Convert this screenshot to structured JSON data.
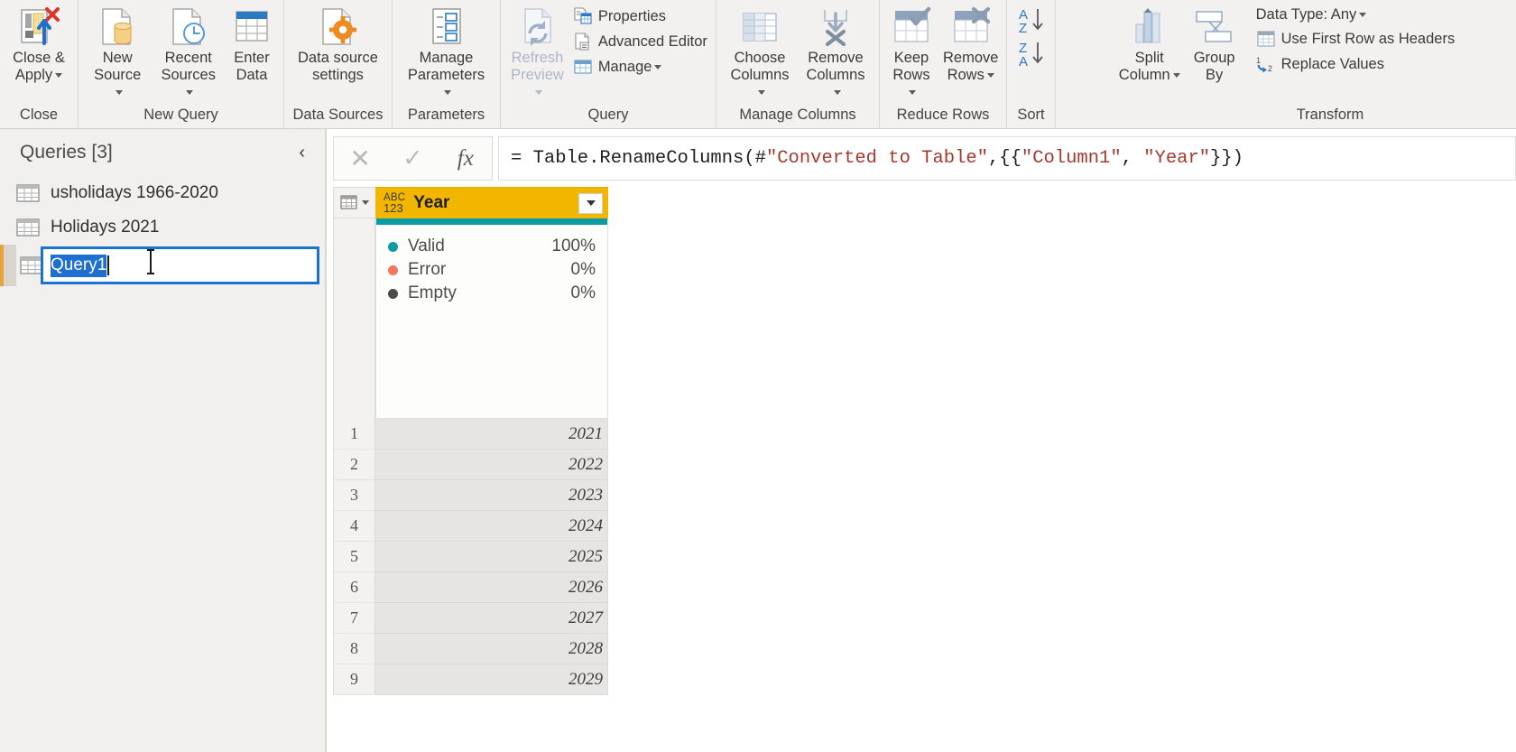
{
  "ribbon": {
    "groups": [
      {
        "title": "Close",
        "items": [
          {
            "label": "Close &\nApply",
            "icon": "close-and-apply-icon",
            "dropdown": true
          }
        ]
      },
      {
        "title": "New Query",
        "items": [
          {
            "label": "New\nSource",
            "icon": "new-source-icon",
            "dropdown": true
          },
          {
            "label": "Recent\nSources",
            "icon": "recent-sources-icon",
            "dropdown": true
          },
          {
            "label": "Enter\nData",
            "icon": "enter-data-icon",
            "dropdown": false
          }
        ]
      },
      {
        "title": "Data Sources",
        "items": [
          {
            "label": "Data source\nsettings",
            "icon": "data-source-settings-icon",
            "dropdown": false
          }
        ]
      },
      {
        "title": "Parameters",
        "items": [
          {
            "label": "Manage\nParameters",
            "icon": "manage-parameters-icon",
            "dropdown": true
          }
        ]
      },
      {
        "title": "Query",
        "items": [
          {
            "label": "Refresh\nPreview",
            "icon": "refresh-preview-icon",
            "dropdown": true,
            "disabled": true
          }
        ],
        "small_items": [
          {
            "label": "Properties",
            "icon": "properties-icon",
            "dropdown": false
          },
          {
            "label": "Advanced Editor",
            "icon": "advanced-editor-icon",
            "dropdown": false
          },
          {
            "label": "Manage",
            "icon": "manage-icon",
            "dropdown": true
          }
        ]
      },
      {
        "title": "Manage Columns",
        "items": [
          {
            "label": "Choose\nColumns",
            "icon": "choose-columns-icon",
            "dropdown": true
          },
          {
            "label": "Remove\nColumns",
            "icon": "remove-columns-icon",
            "dropdown": true
          }
        ]
      },
      {
        "title": "Reduce Rows",
        "items": [
          {
            "label": "Keep\nRows",
            "icon": "keep-rows-icon",
            "dropdown": true
          },
          {
            "label": "Remove\nRows",
            "icon": "remove-rows-icon",
            "dropdown": true
          }
        ]
      },
      {
        "title": "Sort",
        "items": [
          {
            "label": "",
            "icon": "sort-ascending-descending-icon",
            "dropdown": false
          }
        ]
      },
      {
        "title": "Transform",
        "items": [
          {
            "label": "Split\nColumn",
            "icon": "split-column-icon",
            "dropdown": true
          },
          {
            "label": "Group\nBy",
            "icon": "group-by-icon",
            "dropdown": false
          }
        ],
        "small_items": [
          {
            "label": "Data Type: Any",
            "icon": "data-type-icon",
            "dropdown": true
          },
          {
            "label": "Use First Row as Headers",
            "icon": "use-first-row-as-headers-icon",
            "dropdown": false
          },
          {
            "label": "Replace Values",
            "icon": "replace-values-icon",
            "dropdown": false
          }
        ]
      }
    ]
  },
  "queries_pane": {
    "title": "Queries [3]",
    "collapse_label": "‹",
    "items": [
      {
        "label": "usholidays 1966-2020",
        "state": "normal"
      },
      {
        "label": "Holidays 2021",
        "state": "normal"
      },
      {
        "label": "Query1",
        "state": "editing-selected"
      }
    ]
  },
  "formula_bar": {
    "cancel_label": "✕",
    "accept_label": "✓",
    "fx_label": "fx",
    "prefix": "= Table.RenameColumns(#",
    "arg_converted": "\"Converted to Table\"",
    "mid": ",{{",
    "arg_column1": "\"Column1\"",
    "comma": ", ",
    "arg_year": "\"Year\"",
    "suffix": "}})",
    "full_text": "= Table.RenameColumns(#\"Converted to Table\",{{\"Column1\", \"Year\"}})"
  },
  "grid": {
    "column": {
      "name": "Year",
      "type_icon_top": "ABC",
      "type_icon_bottom": "123",
      "header_color": "#f2b600",
      "filter_icon": "chevron-down-icon"
    },
    "quality": {
      "bar_color": "#0b9ba4",
      "rows": [
        {
          "label": "Valid",
          "value": "100%",
          "color": "#0b9ba4"
        },
        {
          "label": "Error",
          "value": "0%",
          "color": "#f4745c"
        },
        {
          "label": "Empty",
          "value": "0%",
          "color": "#4b4b4b"
        }
      ]
    },
    "rows": [
      {
        "num": "1",
        "value": "2021"
      },
      {
        "num": "2",
        "value": "2022"
      },
      {
        "num": "3",
        "value": "2023"
      },
      {
        "num": "4",
        "value": "2024"
      },
      {
        "num": "5",
        "value": "2025"
      },
      {
        "num": "6",
        "value": "2026"
      },
      {
        "num": "7",
        "value": "2027"
      },
      {
        "num": "8",
        "value": "2028"
      },
      {
        "num": "9",
        "value": "2029"
      }
    ]
  },
  "colors": {
    "ribbon_bg": "#f2f1f0",
    "selected_header": "#f2b600",
    "teal": "#0b9ba4",
    "rename_border": "#1a73d1",
    "selection_blue": "#1f6fd0"
  }
}
